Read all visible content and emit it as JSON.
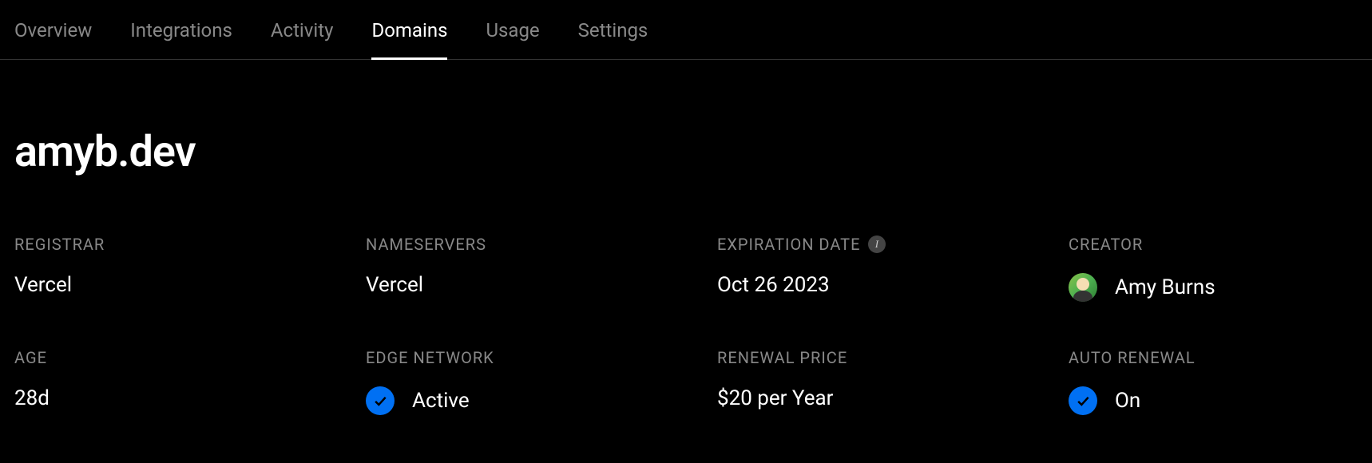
{
  "tabs": [
    {
      "label": "Overview",
      "active": false
    },
    {
      "label": "Integrations",
      "active": false
    },
    {
      "label": "Activity",
      "active": false
    },
    {
      "label": "Domains",
      "active": true
    },
    {
      "label": "Usage",
      "active": false
    },
    {
      "label": "Settings",
      "active": false
    }
  ],
  "domain": {
    "name": "amyb.dev"
  },
  "info": {
    "registrar": {
      "label": "Registrar",
      "value": "Vercel"
    },
    "nameservers": {
      "label": "Nameservers",
      "value": "Vercel"
    },
    "expiration": {
      "label": "Expiration Date",
      "value": "Oct 26 2023"
    },
    "creator": {
      "label": "Creator",
      "value": "Amy Burns"
    },
    "age": {
      "label": "Age",
      "value": "28d"
    },
    "edge_network": {
      "label": "Edge Network",
      "value": "Active"
    },
    "renewal_price": {
      "label": "Renewal Price",
      "value": "$20 per Year"
    },
    "auto_renewal": {
      "label": "Auto Renewal",
      "value": "On"
    }
  }
}
